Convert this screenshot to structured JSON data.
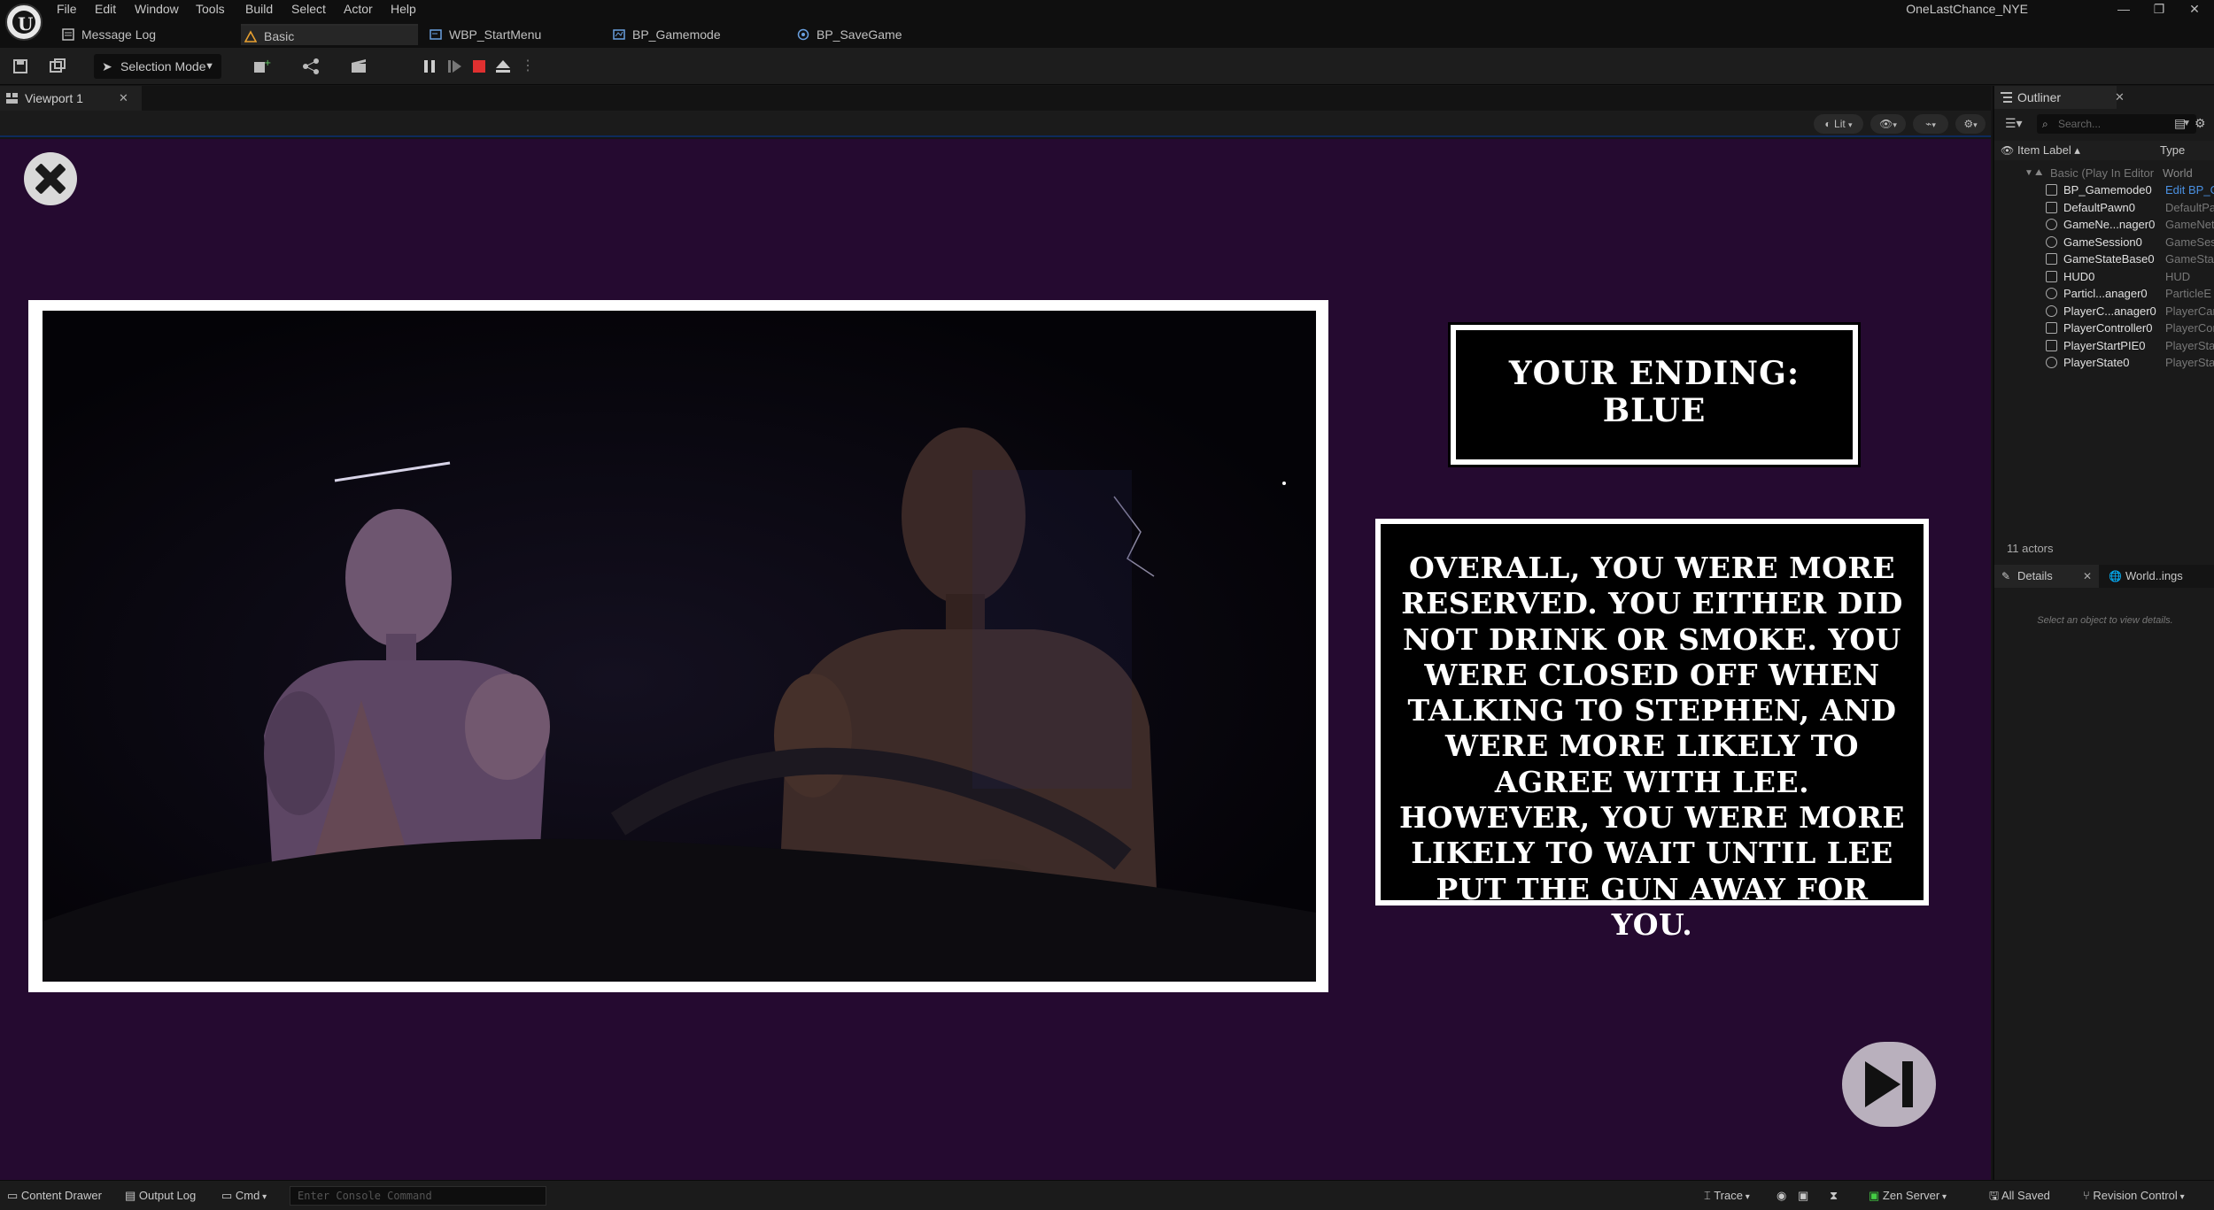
{
  "menu": [
    "File",
    "Edit",
    "Window",
    "Tools",
    "Build",
    "Select",
    "Actor",
    "Help"
  ],
  "project_name": "OneLastChance_NYE",
  "tabs": {
    "message_log": "Message Log",
    "basic": "Basic",
    "wbp_startmenu": "WBP_StartMenu",
    "bp_gamemode": "BP_Gamemode",
    "bp_savegame": "BP_SaveGame"
  },
  "toolbar": {
    "selection_mode": "Selection Mode"
  },
  "viewport": {
    "tab_label": "Viewport 1",
    "lit_label": "Lit"
  },
  "game_ui": {
    "ending_title_line1": "YOUR ENDING:",
    "ending_title_line2": "BLUE",
    "summary": "OVERALL, YOU WERE MORE RESERVED. YOU EITHER DID NOT DRINK OR SMOKE. YOU WERE CLOSED OFF WHEN TALKING TO STEPHEN, AND WERE MORE LIKELY TO AGREE WITH LEE. HOWEVER, YOU WERE MORE LIKELY TO WAIT UNTIL LEE PUT THE GUN AWAY FOR YOU."
  },
  "outliner": {
    "tab_label": "Outliner",
    "search_placeholder": "Search...",
    "col_label": "Item Label ▴",
    "col_type": "Type",
    "world_label": "Basic (Play In Editor",
    "world_type": "World",
    "rows": [
      {
        "label": "BP_Gamemode0",
        "type": "Edit BP_G"
      },
      {
        "label": "DefaultPawn0",
        "type": "DefaultPa"
      },
      {
        "label": "GameNe...nager0",
        "type": "GameNet"
      },
      {
        "label": "GameSession0",
        "type": "GameSes"
      },
      {
        "label": "GameStateBase0",
        "type": "GameStat"
      },
      {
        "label": "HUD0",
        "type": "HUD"
      },
      {
        "label": "Particl...anager0",
        "type": "ParticleE"
      },
      {
        "label": "PlayerC...anager0",
        "type": "PlayerCar"
      },
      {
        "label": "PlayerController0",
        "type": "PlayerCor"
      },
      {
        "label": "PlayerStartPIE0",
        "type": "PlayerSta"
      },
      {
        "label": "PlayerState0",
        "type": "PlayerSta"
      }
    ],
    "actor_count": "11 actors",
    "details_tab": "Details",
    "world_settings_tab": "World..ings",
    "details_hint": "Select an object to view details."
  },
  "statusbar": {
    "content_drawer": "Content Drawer",
    "output_log": "Output Log",
    "cmd": "Cmd",
    "console_placeholder": "Enter Console Command",
    "trace": "Trace",
    "zen_server": "Zen Server",
    "all_saved": "All Saved",
    "revision_control": "Revision Control"
  },
  "colors": {
    "game_background": "#250a30",
    "panel_bg": "#1a1a1a",
    "text_white": "#ffffff"
  }
}
